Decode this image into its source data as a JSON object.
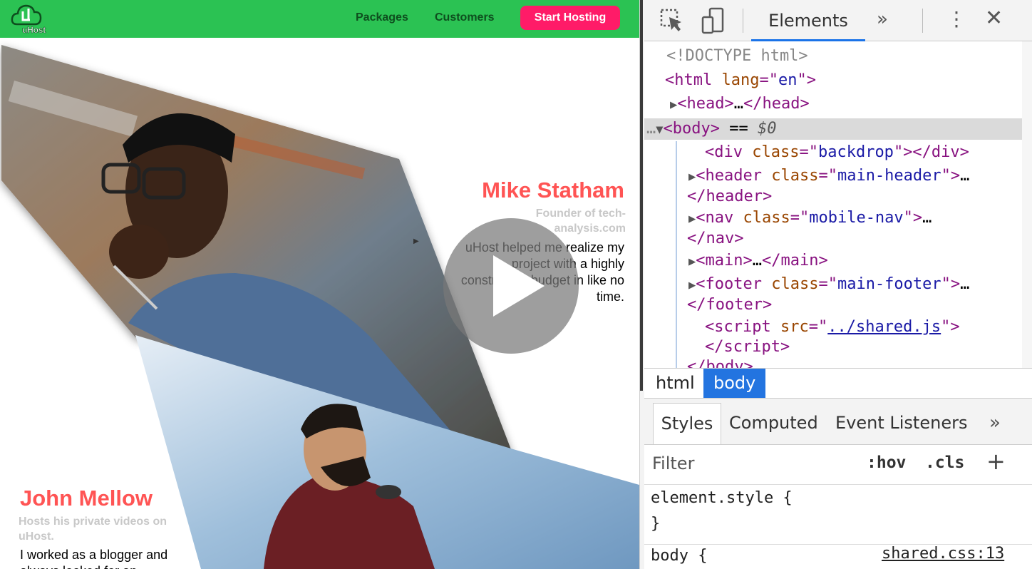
{
  "site": {
    "logo_text": "uHost",
    "nav": {
      "packages": "Packages",
      "customers": "Customers",
      "cta": "Start Hosting"
    },
    "testimonials": [
      {
        "name": "Mike Statham",
        "role": "Founder of tech-analysis.com",
        "quote": "uHost helped me realize my project with a highly constrained budget in like no time."
      },
      {
        "name": "John Mellow",
        "role": "Hosts his private videos on uHost.",
        "quote": "I worked as a blogger and always looked for an"
      }
    ]
  },
  "devtools": {
    "tabs": {
      "elements": "Elements"
    },
    "dom": {
      "doctype": "<!DOCTYPE html>",
      "html_attr": "lang",
      "html_lang": "en",
      "head": "head",
      "body": "body",
      "body_ref": "$0",
      "backdrop_class": "backdrop",
      "header_class": "main-header",
      "nav_class": "mobile-nav",
      "footer_class": "main-footer",
      "script_src": "../shared.js"
    },
    "breadcrumbs": [
      "html",
      "body"
    ],
    "style_tabs": [
      "Styles",
      "Computed",
      "Event Listeners"
    ],
    "filter_placeholder": "Filter",
    "hov": ":hov",
    "cls": ".cls",
    "element_style": "element.style {",
    "close_brace": "}",
    "body_rule": "body {",
    "rule_source": "shared.css:13"
  },
  "colors": {
    "header_bg": "#2bc253",
    "cta_bg": "#ff1b68",
    "name_color": "#ff5454",
    "selected_crumb": "#2374e0"
  }
}
